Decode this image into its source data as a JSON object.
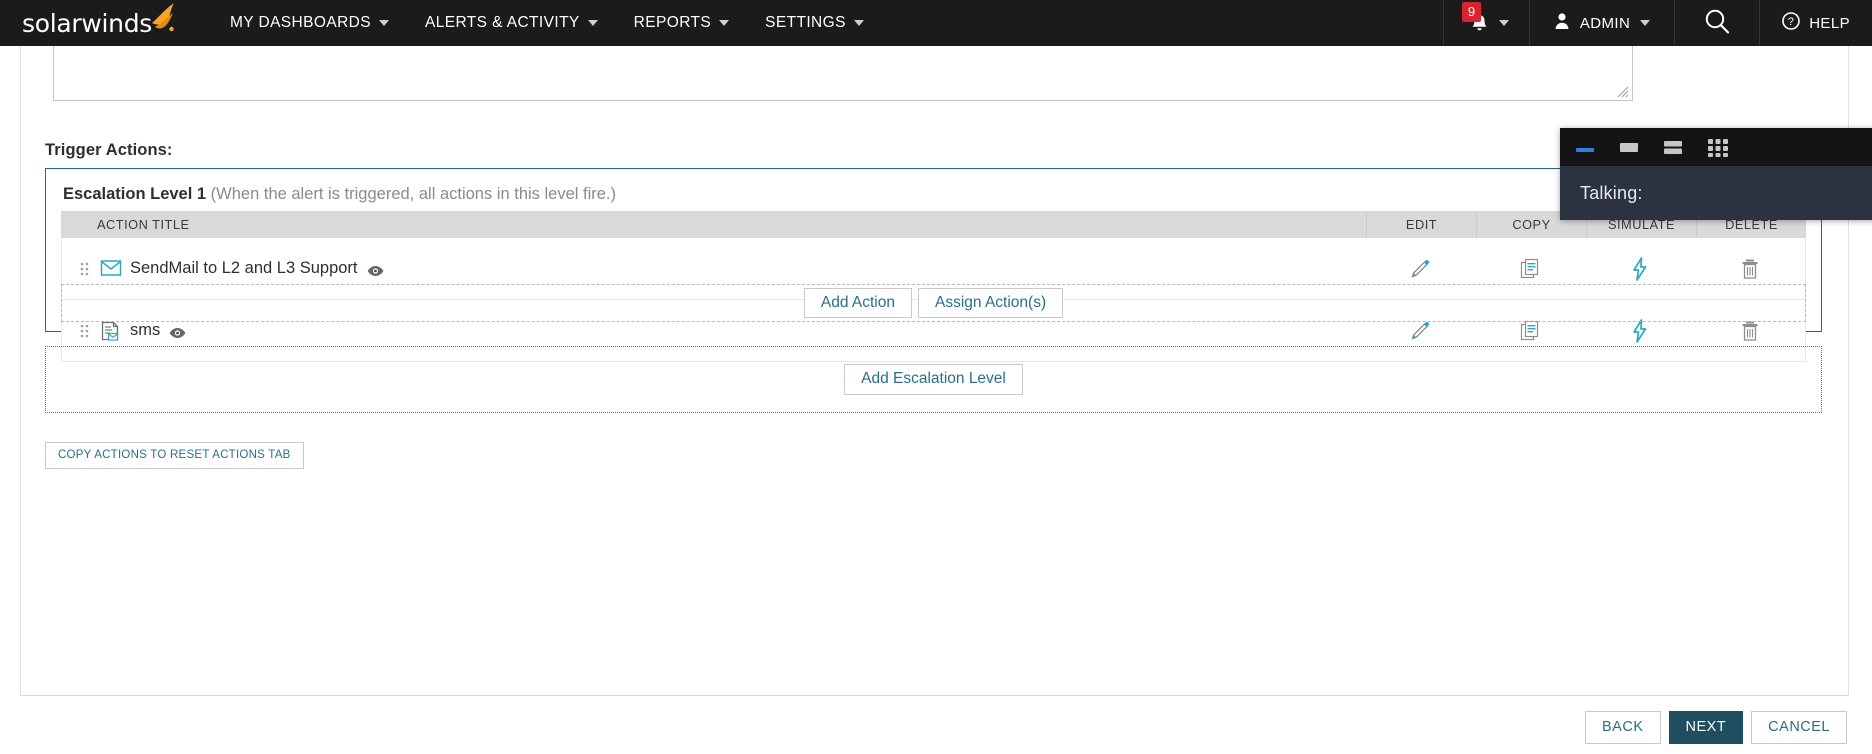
{
  "topnav": {
    "logo_text": "solarwinds",
    "logo_icon": "solarwinds-flame-logo",
    "items": [
      {
        "label": "MY DASHBOARDS",
        "icon": "chevron-down-icon"
      },
      {
        "label": "ALERTS & ACTIVITY",
        "icon": "chevron-down-icon"
      },
      {
        "label": "REPORTS",
        "icon": "chevron-down-icon"
      },
      {
        "label": "SETTINGS",
        "icon": "chevron-down-icon"
      }
    ],
    "notifications": {
      "count": "9",
      "icon": "bell-icon",
      "caret": "chevron-down-icon"
    },
    "admin": {
      "label": "ADMIN",
      "icon": "user-icon",
      "caret": "chevron-down-icon"
    },
    "search": {
      "icon": "search-icon"
    },
    "help": {
      "label": "HELP",
      "icon": "question-circle-icon"
    }
  },
  "main": {
    "description_value": "",
    "description_placeholder": "",
    "section_label": "Trigger Actions:",
    "escalation": {
      "title": "Escalation Level 1",
      "note": "(When the alert is triggered, all actions in this level fire.)",
      "delete_icon": "trash-icon",
      "columns": {
        "title": "ACTION TITLE",
        "edit": "EDIT",
        "copy": "COPY",
        "simulate": "SIMULATE",
        "delete": "DELETE"
      },
      "rows": [
        {
          "title": "SendMail to L2 and L3 Support",
          "type_icon": "mail-envelope-icon",
          "preview_icon": "eye-icon",
          "drag_icon": "drag-handle-icon",
          "edit_icon": "pencil-icon",
          "copy_icon": "document-copy-icon",
          "simulate_icon": "lightning-bolt-icon",
          "delete_icon": "trash-icon"
        },
        {
          "title": "sms",
          "type_icon": "script-document-icon",
          "preview_icon": "eye-icon",
          "drag_icon": "drag-handle-icon",
          "edit_icon": "pencil-icon",
          "copy_icon": "document-copy-icon",
          "simulate_icon": "lightning-bolt-icon",
          "delete_icon": "trash-icon"
        }
      ],
      "add_action_label": "Add Action",
      "assign_actions_label": "Assign Action(s)"
    },
    "add_escalation_label": "Add Escalation Level",
    "copy_reset_label": "COPY ACTIONS TO RESET ACTIONS TAB"
  },
  "footer": {
    "back": "BACK",
    "next": "NEXT",
    "cancel": "CANCEL"
  },
  "overlay": {
    "toolbar_icons": [
      "minimize-bar-icon",
      "single-pane-icon",
      "split-rows-icon",
      "grid-view-icon"
    ],
    "status_text": "Talking:"
  },
  "colors": {
    "nav_bg": "#1b1b1b",
    "brand_orange": "#f5a623",
    "badge_red": "#d9232e",
    "accent_teal": "#2a6f86",
    "escalation_border": "#1f6b78",
    "primary_button": "#1f4e63",
    "overlay_bg": "#1b1b1f",
    "overlay_body": "#2b3240",
    "overlay_active": "#2f7de1"
  }
}
